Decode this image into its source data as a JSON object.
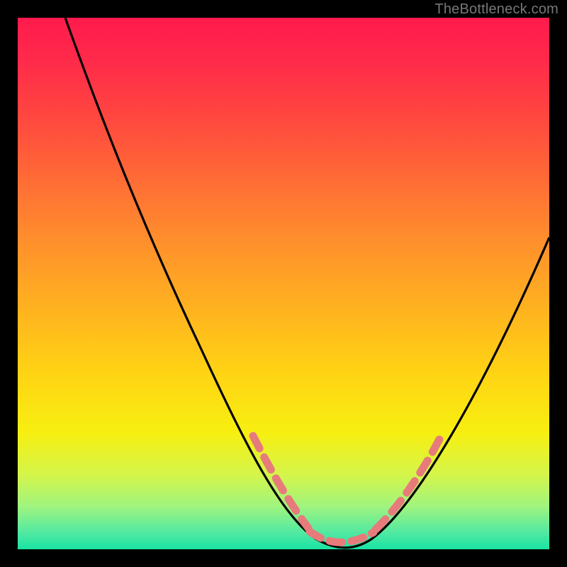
{
  "watermark": "TheBottleneck.com",
  "chart_data": {
    "type": "line",
    "title": "",
    "xlabel": "",
    "ylabel": "",
    "xlim": [
      0,
      100
    ],
    "ylim": [
      0,
      100
    ],
    "series": [
      {
        "name": "bottleneck-curve",
        "x": [
          9,
          12,
          16,
          20,
          24,
          28,
          32,
          36,
          40,
          44,
          48,
          52,
          55,
          57,
          59,
          61,
          63,
          65,
          67,
          70,
          74,
          78,
          82,
          88,
          94,
          100
        ],
        "y": [
          100,
          92,
          82,
          72,
          62,
          53,
          44,
          36,
          28,
          21,
          14,
          8,
          4,
          2,
          1,
          1,
          1,
          2,
          4,
          8,
          15,
          22,
          30,
          40,
          50,
          60
        ]
      }
    ],
    "highlight_segments": [
      {
        "side": "left",
        "x": [
          44,
          56
        ],
        "note": "dashed-salmon"
      },
      {
        "side": "right",
        "x": [
          67,
          78
        ],
        "note": "dashed-salmon"
      },
      {
        "side": "floor",
        "x": [
          55,
          66
        ],
        "note": "dashed-salmon"
      }
    ],
    "colors": {
      "curve": "#000000",
      "highlight": "#e77b7b",
      "background_top": "#ff1a4d",
      "background_bottom": "#19e3a3",
      "frame": "#000000"
    }
  }
}
